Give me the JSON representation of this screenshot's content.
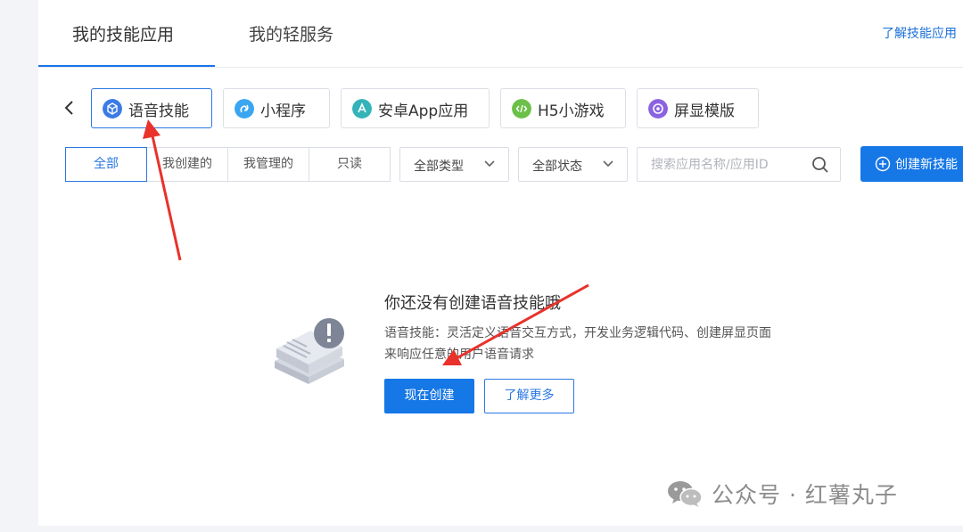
{
  "header": {
    "tabs": [
      {
        "label": "我的技能应用"
      },
      {
        "label": "我的轻服务"
      }
    ],
    "learn_link": "了解技能应用"
  },
  "categories": [
    {
      "label": "语音技能",
      "icon": "cube-icon",
      "color": "#3a7be6"
    },
    {
      "label": "小程序",
      "icon": "link-icon",
      "color": "#3aa5f0"
    },
    {
      "label": "安卓App应用",
      "icon": "app-icon",
      "color": "#34b3b8"
    },
    {
      "label": "H5小游戏",
      "icon": "code-icon",
      "color": "#6cc04a"
    },
    {
      "label": "屏显模版",
      "icon": "target-icon",
      "color": "#8a63e0"
    }
  ],
  "filters": {
    "segments": [
      "全部",
      "我创建的",
      "我管理的",
      "只读"
    ],
    "type_select": "全部类型",
    "status_select": "全部状态",
    "search_placeholder": "搜索应用名称/应用ID",
    "create_button": "创建新技能"
  },
  "empty_state": {
    "title": "你还没有创建语音技能哦",
    "description": "语音技能：灵活定义语音交互方式，开发业务逻辑代码、创建屏显页面来响应任意的用户语音请求",
    "primary_button": "现在创建",
    "secondary_button": "了解更多"
  },
  "watermark": {
    "text": "公众号 · 红薯丸子"
  },
  "colors": {
    "accent": "#1677e6",
    "annotation_arrow": "#e8322b"
  }
}
